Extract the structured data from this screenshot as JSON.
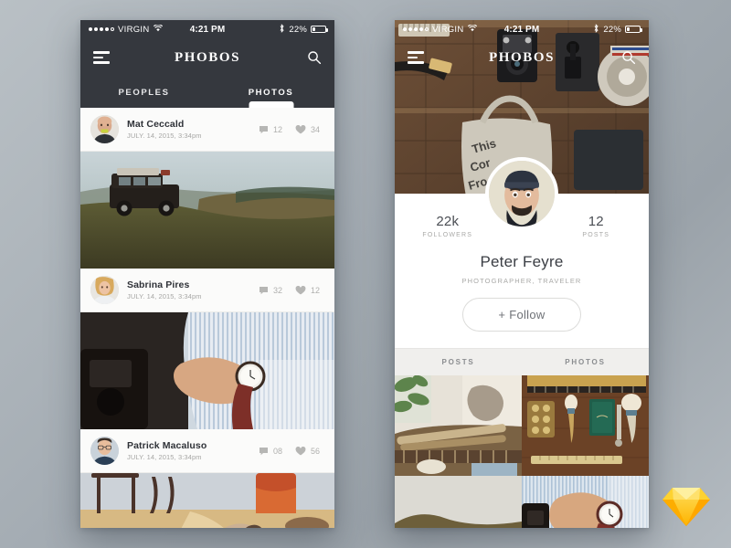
{
  "app": {
    "brand": "PHOBOS",
    "accent_dark": "#35383e",
    "accent_light": "#f0efed"
  },
  "status_bar": {
    "carrier": "VIRGIN",
    "signal_dots_filled": 4,
    "signal_dots_empty": 1,
    "wifi_icon": "wifi-icon",
    "time": "4:21 PM",
    "bluetooth_icon": "bluetooth-icon",
    "battery_percent": "22%",
    "battery_icon": "battery-icon"
  },
  "feed_screen": {
    "nav": {
      "menu_icon": "hamburger-menu-icon",
      "title": "PHOBOS",
      "search_icon": "search-icon"
    },
    "tabs": [
      {
        "label": "PEOPLES",
        "active": false
      },
      {
        "label": "PHOTOS",
        "active": true
      }
    ],
    "posts": [
      {
        "author": "Mat Ceccald",
        "date": "JULY. 14, 2015, 3:34pm",
        "comments": "12",
        "likes": "34",
        "photo_alt": "land-rover-on-hillside"
      },
      {
        "author": "Sabrina Pires",
        "date": "JULY. 14, 2015, 3:34pm",
        "comments": "32",
        "likes": "12",
        "photo_alt": "wristwatch-and-shirt-cuff"
      },
      {
        "author": "Patrick Macaluso",
        "date": "JULY. 14, 2015, 3:34pm",
        "comments": "08",
        "likes": "56",
        "photo_alt": "cat-on-sunlit-wooden-floor"
      }
    ],
    "comment_icon": "comment-bubble-icon",
    "like_icon": "heart-icon"
  },
  "profile_screen": {
    "nav": {
      "menu_icon": "hamburger-menu-icon",
      "title": "PHOBOS",
      "search_icon": "search-icon"
    },
    "hero_alt": "flat-lay-vintage-camera-gear-on-wood-floor",
    "avatar_alt": "peter-feyre-portrait-with-beanie",
    "followers_count": "22k",
    "followers_label": "FOLLOWERS",
    "posts_count": "12",
    "posts_label": "POSTS",
    "name": "Peter Feyre",
    "role": "PHOTOGRAPHER, TRAVELER",
    "follow_button": "+ Follow",
    "tabs": [
      {
        "label": "POSTS",
        "active": false
      },
      {
        "label": "PHOTOS",
        "active": true
      }
    ],
    "gallery": [
      {
        "alt": "rolled-brushes-on-table-by-window"
      },
      {
        "alt": "shaving-brushes-green-notebook-flatlay"
      },
      {
        "alt": "sand-dune-minimal-landscape"
      },
      {
        "alt": "hand-with-watch-striped-shirt"
      }
    ]
  },
  "watermark": {
    "icon": "sketch-diamond-logo"
  }
}
